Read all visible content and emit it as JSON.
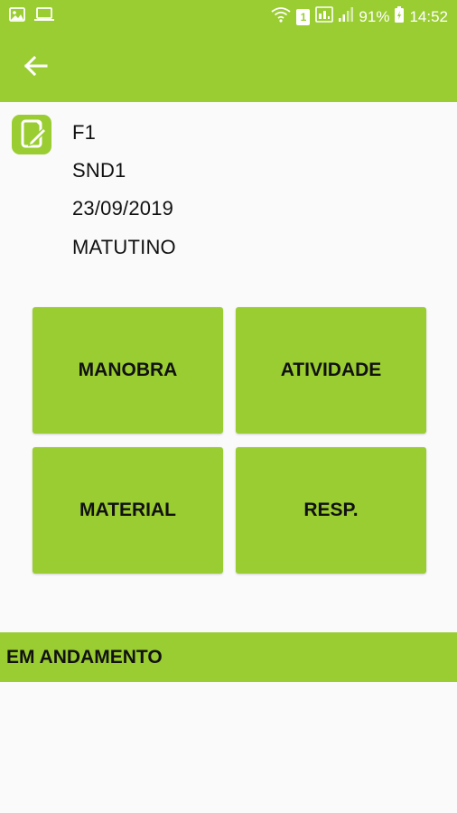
{
  "status_bar": {
    "battery": "91%",
    "time": "14:52",
    "sim": "1",
    "left_icons": [
      "image-icon",
      "laptop-icon"
    ],
    "right_icons": [
      "wifi-icon",
      "sim-icon",
      "signal-icon",
      "battery-icon"
    ]
  },
  "app_bar": {
    "back_icon": "arrow-left-icon",
    "color": "#9acd32"
  },
  "header": {
    "icon": "edit-document-icon",
    "lines": [
      "F1",
      "SND1",
      "23/09/2019",
      "MATUTINO"
    ]
  },
  "menu": {
    "buttons": [
      "MANOBRA",
      "ATIVIDADE",
      "MATERIAL",
      "RESP."
    ]
  },
  "section": {
    "title": "EM ANDAMENTO"
  }
}
